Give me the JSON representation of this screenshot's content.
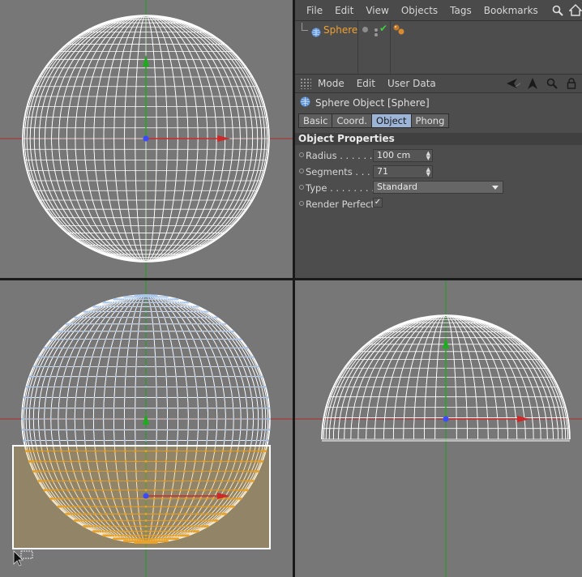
{
  "object_manager": {
    "menu": [
      "File",
      "Edit",
      "View",
      "Objects",
      "Tags",
      "Bookmarks"
    ],
    "icons": [
      "search-icon",
      "home-icon"
    ],
    "object": {
      "name": "Sphere",
      "icon": "sphere-icon"
    }
  },
  "attribute_manager": {
    "menu": [
      "Mode",
      "Edit",
      "User Data"
    ],
    "icons": [
      "back-arrow-icon",
      "pointer-icon",
      "search-icon",
      "lock-icon"
    ],
    "title": "Sphere Object [Sphere]",
    "tabs": [
      "Basic",
      "Coord.",
      "Object",
      "Phong"
    ],
    "active_tab": "Object",
    "section": "Object Properties",
    "properties": {
      "radius": {
        "label": "Radius . . . . . . .",
        "value": "100 cm"
      },
      "segments": {
        "label": "Segments . . . .",
        "value": "71"
      },
      "type": {
        "label": "Type . . . . . . . .",
        "value": "Standard"
      },
      "render_perfect": {
        "label": "Render Perfect",
        "value": "✓"
      }
    }
  },
  "colors": {
    "viewport_bg": "#777777",
    "wire": "#ffffff",
    "selected": "#f0a020",
    "axis_x": "#cc2a2a",
    "axis_y": "#1faa1f",
    "accent_tab": "#9bb4d8"
  }
}
